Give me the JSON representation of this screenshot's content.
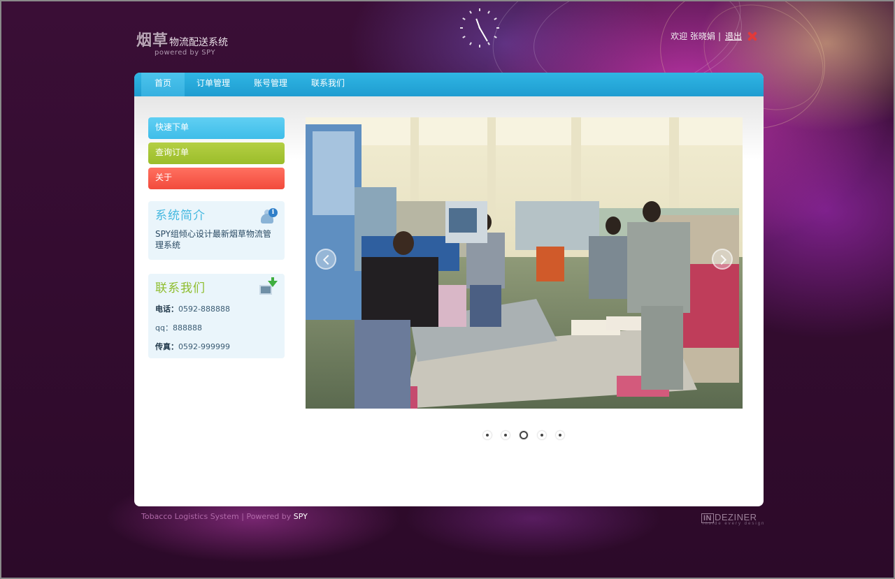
{
  "header": {
    "logo_big": "烟草",
    "logo_small": "物流配送系统",
    "logo_sub": "powered by SPY",
    "welcome": "欢迎 张晓娟",
    "separator": "|",
    "logout_label": "退出"
  },
  "nav": {
    "items": [
      {
        "label": "首页",
        "active": true
      },
      {
        "label": "订单管理",
        "active": false
      },
      {
        "label": "账号管理",
        "active": false
      },
      {
        "label": "联系我们",
        "active": false
      }
    ]
  },
  "sidebar": {
    "quick_buttons": [
      {
        "label": "快速下单",
        "color": "#4ec6ef"
      },
      {
        "label": "查询订单",
        "color": "#a6c637"
      },
      {
        "label": "关于",
        "color": "#f75b4b"
      }
    ],
    "intro": {
      "title": "系统简介",
      "text": "SPY组倾心设计最新烟草物流管理系统"
    },
    "contact": {
      "title": "联系我们",
      "phone_label": "电话：",
      "phone": "0592-888888",
      "qq_label": "qq：",
      "qq": "888888",
      "fax_label": "传真：",
      "fax": "0592-999999"
    }
  },
  "slider": {
    "slide_count": 5,
    "active_index": 2
  },
  "footer": {
    "system_name": "Tobacco Logistics System",
    "separator": "|",
    "powered_by": "Powered by",
    "brand": "SPY",
    "designer_box": "IN",
    "designer_name": "DEZINER",
    "designer_tagline": "inside every design"
  },
  "colors": {
    "nav": "#1f9cd0",
    "intro_title": "#46b9e0",
    "contact_title": "#8ebd2d",
    "background": "#2e0b2b"
  }
}
